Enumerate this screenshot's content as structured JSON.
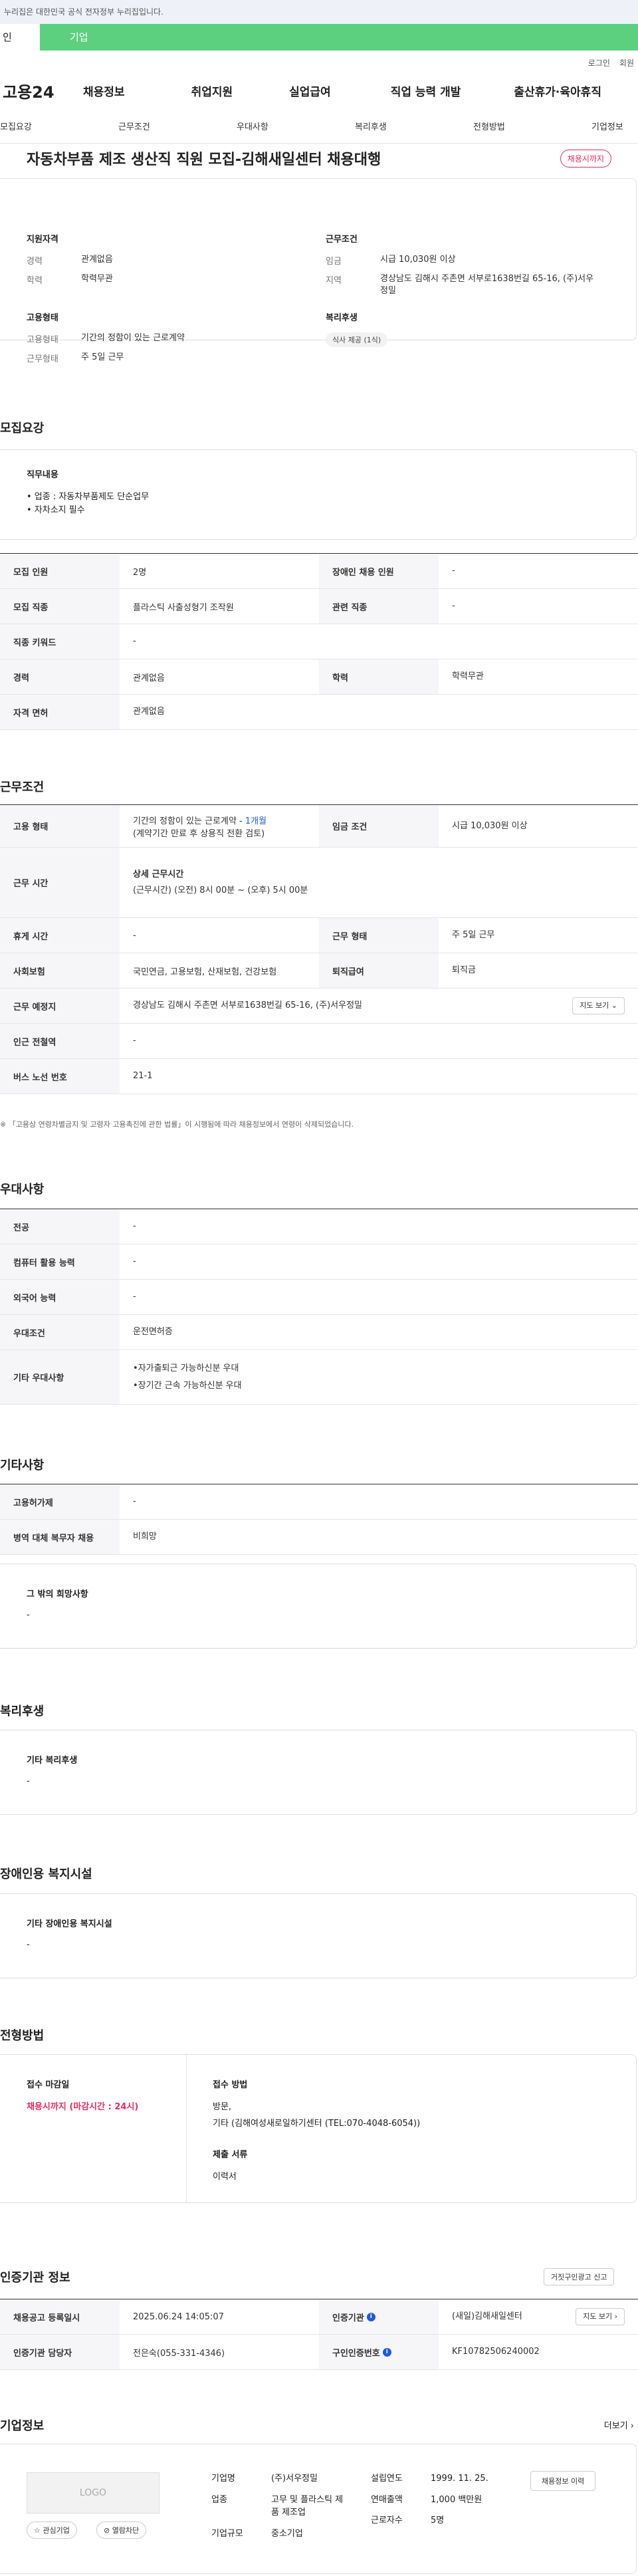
{
  "gov_bar": "누리집은 대한민국 공식 전자정부 누리집입니다.",
  "user_type": {
    "individual": "인",
    "company": "기업"
  },
  "util": {
    "login": "로그인",
    "join": "회원"
  },
  "logo": "고용24",
  "gnb": [
    "채용정보",
    "취업지원",
    "실업급여",
    "직업 능력 개발",
    "출산휴가·육아휴직"
  ],
  "tabs": [
    "모집요강",
    "근무조건",
    "우대사항",
    "복리후생",
    "전형방법",
    "기업정보"
  ],
  "job_title": "자동차부품 제조 생산직 직원 모집-김해새일센터 채용대행",
  "status_badge": "채용시까지",
  "summary": {
    "qual_h": "지원자격",
    "career_k": "경력",
    "career_v": "관계없음",
    "edu_k": "학력",
    "edu_v": "학력무관",
    "emp_h": "고용형태",
    "emptype_k": "고용형태",
    "emptype_v": "기간의 정함이 있는 근로계약",
    "worktype_k": "근무형태",
    "worktype_v": "주 5일 근무",
    "cond_h": "근무조건",
    "wage_k": "임금",
    "wage_v": "시급 10,030원 이상",
    "region_k": "지역",
    "region_v": "경상남도 김해시 주촌면 서부로1638번길 65-16, (주)서우정밀",
    "welfare_h": "복리후생",
    "welfare_chip": "식사 제공 (1식)"
  },
  "recruit": {
    "title": "모집요강",
    "duty_h": "직무내용",
    "duty_lines": [
      "• 업종 : 자동차부품제도 단순업무",
      "• 자차소지 필수"
    ],
    "rows": {
      "count_k": "모집 인원",
      "count_v": "2명",
      "disabled_k": "장애인 채용 인원",
      "disabled_v": "-",
      "job_k": "모집 직종",
      "job_v": "플라스틱 사출성형기 조작원",
      "related_k": "관련 직종",
      "related_v": "-",
      "keyword_k": "직종 키워드",
      "keyword_v": "-",
      "career_k": "경력",
      "career_v": "관계없음",
      "edu_k": "학력",
      "edu_v": "학력무관",
      "license_k": "자격 면허",
      "license_v": "관계없음"
    }
  },
  "work": {
    "title": "근무조건",
    "emp_k": "고용 형태",
    "emp_v1": "기간의 정함이 있는 근로계약 - ",
    "emp_period": "1개월",
    "emp_v2": "(계약기간 만료 후 상용직 전환 검토)",
    "wage_k": "임금 조건",
    "wage_v": "시급 10,030원 이상",
    "hours_k": "근무 시간",
    "hours_h": "상세 근무시간",
    "hours_v": "(근무시간) (오전) 8시 00분 ~ (오후) 5시 00분",
    "rest_k": "휴게 시간",
    "rest_v": "-",
    "form_k": "근무 형태",
    "form_v": "주 5일 근무",
    "ins_k": "사회보험",
    "ins_v": "국민연금, 고용보험, 산재보험, 건강보험",
    "sev_k": "퇴직급여",
    "sev_v": "퇴직금",
    "place_k": "근무 예정지",
    "place_v": "경상남도 김해시 주촌면 서부로1638번길 65-16, (주)서우정밀",
    "map_btn": "지도 보기 ⌄",
    "subway_k": "인근 전철역",
    "subway_v": "-",
    "bus_k": "버스 노선 번호",
    "bus_v": "21-1",
    "note": "※ 「고용상 연령차별금지 및 고령자 고용촉진에 관한 법률」이 시행됨에 따라 채용정보에서 연령이 삭제되었습니다."
  },
  "pref": {
    "title": "우대사항",
    "major_k": "전공",
    "major_v": "-",
    "pc_k": "컴퓨터 활용 능력",
    "pc_v": "-",
    "lang_k": "외국어 능력",
    "lang_v": "-",
    "cond_k": "우대조건",
    "cond_v": "운전면허증",
    "etc_k": "기타 우대사항",
    "etc_v1": "•자가출퇴근 가능하신분 우대",
    "etc_v2": "•장기간 근속 가능하신분 우대"
  },
  "etc": {
    "title": "기타사항",
    "insure_k": "고용허가제",
    "insure_v": "-",
    "mil_k": "병역 대체 복무자 채용",
    "mil_v": "비희망",
    "hope_h": "그 밖의 희망사항",
    "hope_v": "-"
  },
  "welfare": {
    "title": "복리후생",
    "etc_h": "기타 복리후생",
    "etc_v": "-"
  },
  "disab": {
    "title": "장애인용 복지시설",
    "etc_h": "기타 장애인용 복지시설",
    "etc_v": "-"
  },
  "selection": {
    "title": "전형방법",
    "deadline_h": "접수 마감일",
    "deadline_v": "채용시까지 (마감시간 : 24시)",
    "method_h": "접수 방법",
    "method_v1": "방문,",
    "method_v2": "기타 (김해여성새로일하기센터 (TEL:070-4048-6054))",
    "docs_h": "제출 서류",
    "docs_v": "이력서"
  },
  "agency": {
    "title": "인증기관 정보",
    "report_btn": "거짓구인광고 신고",
    "reg_k": "채용공고 등록일시",
    "reg_v": "2025.06.24 14:05:07",
    "org_k": "인증기관",
    "org_v": "(새일)김해새일센터",
    "map_btn": "지도 보기 ›",
    "mgr_k": "인증기관 담당자",
    "mgr_v": "전은숙(055-331-4346)",
    "no_k": "구인인증번호",
    "no_v": "KF10782506240002"
  },
  "company": {
    "title": "기업정보",
    "more": "더보기 ›",
    "logo_text": "LOGO",
    "fav_btn": "☆ 관심기업",
    "block_btn": "⊘ 열람차단",
    "name_k": "기업명",
    "name_v": "(주)서우정밀",
    "ind_k": "업종",
    "ind_v": "고무 및 플라스틱 제품 제조업",
    "size_k": "기업규모",
    "size_v": "중소기업",
    "year_k": "설립연도",
    "year_v": "1999. 11. 25.",
    "sales_k": "연매출액",
    "sales_v": "1,000 백만원",
    "emp_k": "근로자수",
    "emp_v": "5명",
    "jobs_btn": "채용정보 이력"
  }
}
